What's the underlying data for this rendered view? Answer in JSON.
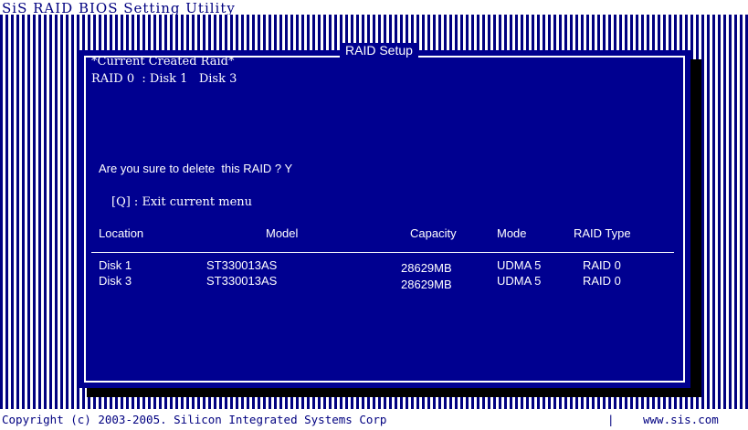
{
  "app": {
    "title": "SiS RAID BIOS Setting Utility"
  },
  "dialog": {
    "title": "RAID Setup",
    "created_heading": "*Current Created Raid*",
    "raid_line": "RAID 0  : Disk 1   Disk 3",
    "prompt": "Are you sure to delete  this RAID ? Y",
    "exit_hint": "[Q] : Exit current menu"
  },
  "table": {
    "columns": [
      "Location",
      "Model",
      "Capacity",
      "Mode",
      "RAID Type"
    ],
    "rows": [
      [
        "Disk 1",
        "ST330013AS",
        "28629MB",
        "UDMA 5",
        "RAID 0"
      ],
      [
        "Disk 3",
        "ST330013AS",
        "28629MB",
        "UDMA 5",
        "RAID 0"
      ]
    ]
  },
  "footer": {
    "copyright": "Copyright (c) 2003-2005. Silicon Integrated Systems Corp",
    "separator": "|",
    "url": "www.sis.com"
  },
  "colors": {
    "background": "#000090",
    "text": "#ffffff",
    "frame": "#000080"
  }
}
